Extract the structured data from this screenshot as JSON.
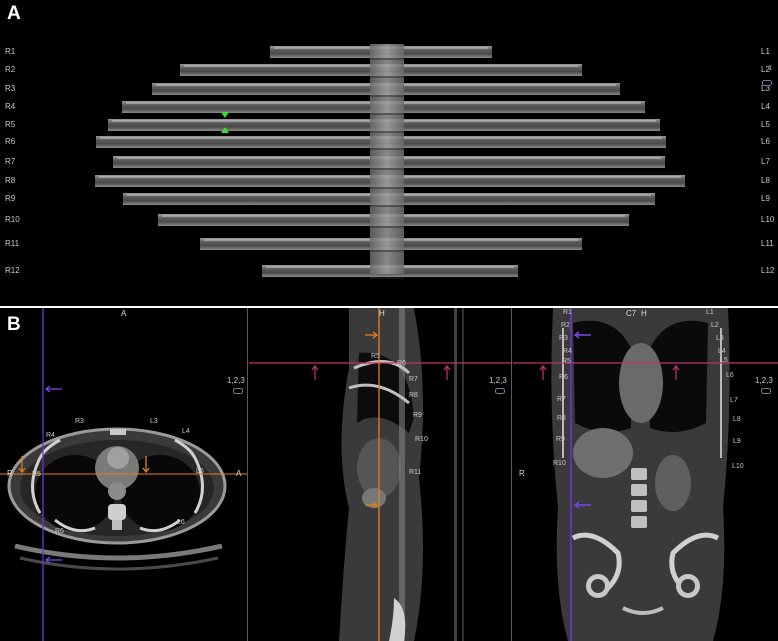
{
  "panel_a": {
    "label": "A",
    "right_rib_labels": [
      "R1",
      "R2",
      "R3",
      "R4",
      "R5",
      "R6",
      "R7",
      "R8",
      "R9",
      "R10",
      "R11",
      "R12"
    ],
    "left_rib_labels": [
      "L1",
      "L2",
      "L3",
      "L4",
      "L5",
      "L6",
      "L7",
      "L8",
      "L9",
      "L10",
      "L11",
      "L12"
    ],
    "corner_text": "1",
    "marker_color": "#35e035"
  },
  "panel_b": {
    "label": "B",
    "axial": {
      "top_orientation": "A",
      "left_orientation": "R",
      "right_orientation": "A",
      "rib_labels": [
        "R3",
        "L3",
        "R4",
        "L4",
        "R5",
        "L5",
        "R6",
        "L6"
      ],
      "view_code": "1,2,3"
    },
    "sagittal": {
      "top_orientation": "H",
      "rib_labels": [
        "R5",
        "R6",
        "R7",
        "R8",
        "R9",
        "R10",
        "R11"
      ],
      "view_code": "1,2,3"
    },
    "coronal": {
      "top_label": "C7",
      "top_orientation": "H",
      "left_orientation": "R",
      "rib_labels_right": [
        "R1",
        "R2",
        "R3",
        "R4",
        "R5",
        "R6",
        "R7",
        "R8",
        "R9",
        "R10"
      ],
      "rib_labels_left": [
        "L1",
        "L2",
        "L3",
        "L4",
        "L5",
        "L6",
        "L7",
        "L8",
        "L9",
        "L10"
      ],
      "view_code": "1,2,3"
    },
    "colors": {
      "crosshair_magenta": "#c0306a",
      "crosshair_purple": "#6a35d8",
      "crosshair_orange": "#e0801a",
      "arrow_orange": "#e0801a",
      "arrow_magenta": "#c0306a",
      "arrow_purple": "#7a45e8"
    }
  }
}
